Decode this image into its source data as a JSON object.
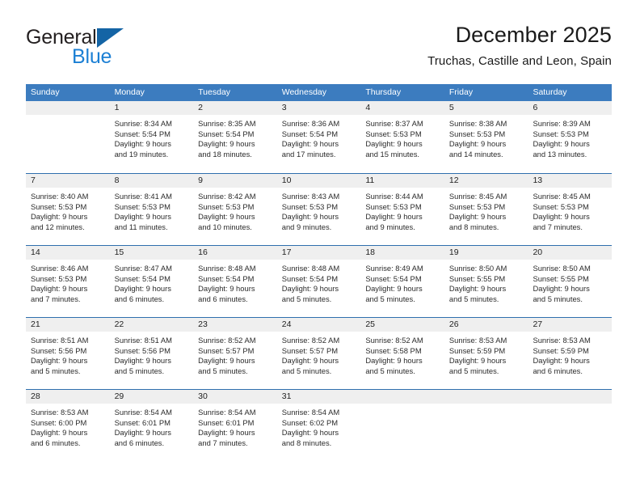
{
  "brand": {
    "name_part1": "General",
    "name_part2": "Blue",
    "triangle_color": "#1464a5",
    "blue_text_color": "#1b7fd4"
  },
  "header": {
    "title": "December 2025",
    "subtitle": "Truchas, Castille and Leon, Spain"
  },
  "colors": {
    "header_bar": "#3c7cbf",
    "week_divider": "#2f6fae",
    "day_number_band": "#efefef"
  },
  "weekdays": [
    "Sunday",
    "Monday",
    "Tuesday",
    "Wednesday",
    "Thursday",
    "Friday",
    "Saturday"
  ],
  "weeks": [
    [
      {
        "day": "",
        "sunrise": "",
        "sunset": "",
        "daylight1": "",
        "daylight2": "",
        "empty": true
      },
      {
        "day": "1",
        "sunrise": "Sunrise: 8:34 AM",
        "sunset": "Sunset: 5:54 PM",
        "daylight1": "Daylight: 9 hours",
        "daylight2": "and 19 minutes."
      },
      {
        "day": "2",
        "sunrise": "Sunrise: 8:35 AM",
        "sunset": "Sunset: 5:54 PM",
        "daylight1": "Daylight: 9 hours",
        "daylight2": "and 18 minutes."
      },
      {
        "day": "3",
        "sunrise": "Sunrise: 8:36 AM",
        "sunset": "Sunset: 5:54 PM",
        "daylight1": "Daylight: 9 hours",
        "daylight2": "and 17 minutes."
      },
      {
        "day": "4",
        "sunrise": "Sunrise: 8:37 AM",
        "sunset": "Sunset: 5:53 PM",
        "daylight1": "Daylight: 9 hours",
        "daylight2": "and 15 minutes."
      },
      {
        "day": "5",
        "sunrise": "Sunrise: 8:38 AM",
        "sunset": "Sunset: 5:53 PM",
        "daylight1": "Daylight: 9 hours",
        "daylight2": "and 14 minutes."
      },
      {
        "day": "6",
        "sunrise": "Sunrise: 8:39 AM",
        "sunset": "Sunset: 5:53 PM",
        "daylight1": "Daylight: 9 hours",
        "daylight2": "and 13 minutes."
      }
    ],
    [
      {
        "day": "7",
        "sunrise": "Sunrise: 8:40 AM",
        "sunset": "Sunset: 5:53 PM",
        "daylight1": "Daylight: 9 hours",
        "daylight2": "and 12 minutes."
      },
      {
        "day": "8",
        "sunrise": "Sunrise: 8:41 AM",
        "sunset": "Sunset: 5:53 PM",
        "daylight1": "Daylight: 9 hours",
        "daylight2": "and 11 minutes."
      },
      {
        "day": "9",
        "sunrise": "Sunrise: 8:42 AM",
        "sunset": "Sunset: 5:53 PM",
        "daylight1": "Daylight: 9 hours",
        "daylight2": "and 10 minutes."
      },
      {
        "day": "10",
        "sunrise": "Sunrise: 8:43 AM",
        "sunset": "Sunset: 5:53 PM",
        "daylight1": "Daylight: 9 hours",
        "daylight2": "and 9 minutes."
      },
      {
        "day": "11",
        "sunrise": "Sunrise: 8:44 AM",
        "sunset": "Sunset: 5:53 PM",
        "daylight1": "Daylight: 9 hours",
        "daylight2": "and 9 minutes."
      },
      {
        "day": "12",
        "sunrise": "Sunrise: 8:45 AM",
        "sunset": "Sunset: 5:53 PM",
        "daylight1": "Daylight: 9 hours",
        "daylight2": "and 8 minutes."
      },
      {
        "day": "13",
        "sunrise": "Sunrise: 8:45 AM",
        "sunset": "Sunset: 5:53 PM",
        "daylight1": "Daylight: 9 hours",
        "daylight2": "and 7 minutes."
      }
    ],
    [
      {
        "day": "14",
        "sunrise": "Sunrise: 8:46 AM",
        "sunset": "Sunset: 5:53 PM",
        "daylight1": "Daylight: 9 hours",
        "daylight2": "and 7 minutes."
      },
      {
        "day": "15",
        "sunrise": "Sunrise: 8:47 AM",
        "sunset": "Sunset: 5:54 PM",
        "daylight1": "Daylight: 9 hours",
        "daylight2": "and 6 minutes."
      },
      {
        "day": "16",
        "sunrise": "Sunrise: 8:48 AM",
        "sunset": "Sunset: 5:54 PM",
        "daylight1": "Daylight: 9 hours",
        "daylight2": "and 6 minutes."
      },
      {
        "day": "17",
        "sunrise": "Sunrise: 8:48 AM",
        "sunset": "Sunset: 5:54 PM",
        "daylight1": "Daylight: 9 hours",
        "daylight2": "and 5 minutes."
      },
      {
        "day": "18",
        "sunrise": "Sunrise: 8:49 AM",
        "sunset": "Sunset: 5:54 PM",
        "daylight1": "Daylight: 9 hours",
        "daylight2": "and 5 minutes."
      },
      {
        "day": "19",
        "sunrise": "Sunrise: 8:50 AM",
        "sunset": "Sunset: 5:55 PM",
        "daylight1": "Daylight: 9 hours",
        "daylight2": "and 5 minutes."
      },
      {
        "day": "20",
        "sunrise": "Sunrise: 8:50 AM",
        "sunset": "Sunset: 5:55 PM",
        "daylight1": "Daylight: 9 hours",
        "daylight2": "and 5 minutes."
      }
    ],
    [
      {
        "day": "21",
        "sunrise": "Sunrise: 8:51 AM",
        "sunset": "Sunset: 5:56 PM",
        "daylight1": "Daylight: 9 hours",
        "daylight2": "and 5 minutes."
      },
      {
        "day": "22",
        "sunrise": "Sunrise: 8:51 AM",
        "sunset": "Sunset: 5:56 PM",
        "daylight1": "Daylight: 9 hours",
        "daylight2": "and 5 minutes."
      },
      {
        "day": "23",
        "sunrise": "Sunrise: 8:52 AM",
        "sunset": "Sunset: 5:57 PM",
        "daylight1": "Daylight: 9 hours",
        "daylight2": "and 5 minutes."
      },
      {
        "day": "24",
        "sunrise": "Sunrise: 8:52 AM",
        "sunset": "Sunset: 5:57 PM",
        "daylight1": "Daylight: 9 hours",
        "daylight2": "and 5 minutes."
      },
      {
        "day": "25",
        "sunrise": "Sunrise: 8:52 AM",
        "sunset": "Sunset: 5:58 PM",
        "daylight1": "Daylight: 9 hours",
        "daylight2": "and 5 minutes."
      },
      {
        "day": "26",
        "sunrise": "Sunrise: 8:53 AM",
        "sunset": "Sunset: 5:59 PM",
        "daylight1": "Daylight: 9 hours",
        "daylight2": "and 5 minutes."
      },
      {
        "day": "27",
        "sunrise": "Sunrise: 8:53 AM",
        "sunset": "Sunset: 5:59 PM",
        "daylight1": "Daylight: 9 hours",
        "daylight2": "and 6 minutes."
      }
    ],
    [
      {
        "day": "28",
        "sunrise": "Sunrise: 8:53 AM",
        "sunset": "Sunset: 6:00 PM",
        "daylight1": "Daylight: 9 hours",
        "daylight2": "and 6 minutes."
      },
      {
        "day": "29",
        "sunrise": "Sunrise: 8:54 AM",
        "sunset": "Sunset: 6:01 PM",
        "daylight1": "Daylight: 9 hours",
        "daylight2": "and 6 minutes."
      },
      {
        "day": "30",
        "sunrise": "Sunrise: 8:54 AM",
        "sunset": "Sunset: 6:01 PM",
        "daylight1": "Daylight: 9 hours",
        "daylight2": "and 7 minutes."
      },
      {
        "day": "31",
        "sunrise": "Sunrise: 8:54 AM",
        "sunset": "Sunset: 6:02 PM",
        "daylight1": "Daylight: 9 hours",
        "daylight2": "and 8 minutes."
      },
      {
        "day": "",
        "sunrise": "",
        "sunset": "",
        "daylight1": "",
        "daylight2": "",
        "empty": true
      },
      {
        "day": "",
        "sunrise": "",
        "sunset": "",
        "daylight1": "",
        "daylight2": "",
        "empty": true
      },
      {
        "day": "",
        "sunrise": "",
        "sunset": "",
        "daylight1": "",
        "daylight2": "",
        "empty": true
      }
    ]
  ]
}
